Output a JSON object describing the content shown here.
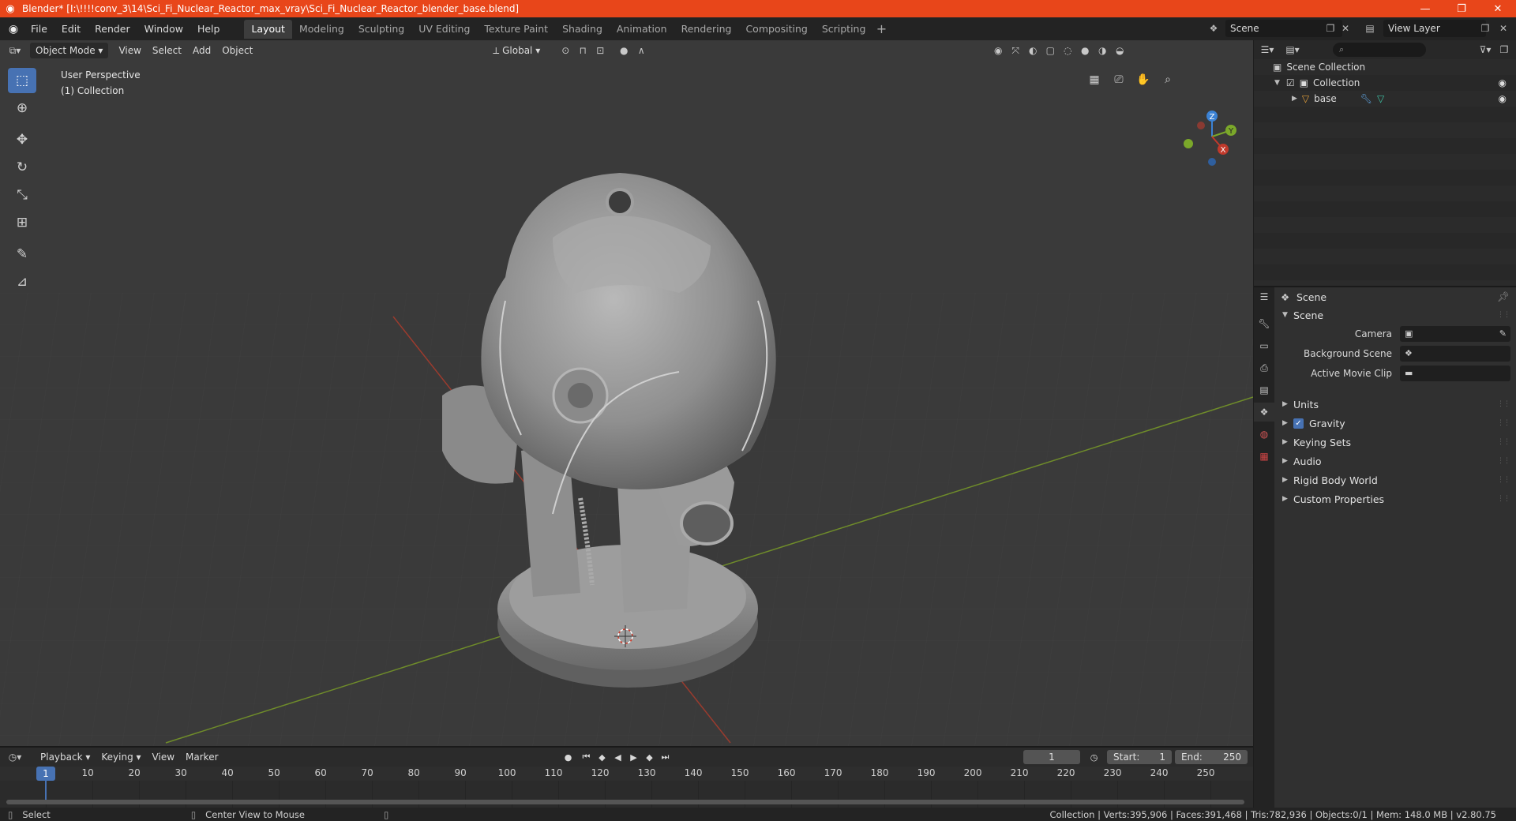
{
  "title": "Blender* [I:\\!!!!conv_3\\14\\Sci_Fi_Nuclear_Reactor_max_vray\\Sci_Fi_Nuclear_Reactor_blender_base.blend]",
  "menu": [
    "File",
    "Edit",
    "Render",
    "Window",
    "Help"
  ],
  "workspaces": [
    "Layout",
    "Modeling",
    "Sculpting",
    "UV Editing",
    "Texture Paint",
    "Shading",
    "Animation",
    "Rendering",
    "Compositing",
    "Scripting"
  ],
  "active_workspace": "Layout",
  "scene_name": "Scene",
  "view_layer": "View Layer",
  "viewport": {
    "mode": "Object Mode",
    "menus": [
      "View",
      "Select",
      "Add",
      "Object"
    ],
    "orientation": "Global",
    "perspective": "User Perspective",
    "collection": "(1) Collection"
  },
  "outliner": {
    "root": "Scene Collection",
    "collection": "Collection",
    "object": "base"
  },
  "properties": {
    "header": "Scene",
    "panel_title": "Scene",
    "fields": [
      {
        "label": "Camera"
      },
      {
        "label": "Background Scene"
      },
      {
        "label": "Active Movie Clip"
      }
    ],
    "sections": [
      "Units",
      "Gravity",
      "Keying Sets",
      "Audio",
      "Rigid Body World",
      "Custom Properties"
    ]
  },
  "timeline": {
    "menus": [
      "Playback",
      "Keying",
      "View",
      "Marker"
    ],
    "current_frame": "1",
    "start_label": "Start:",
    "start": "1",
    "end_label": "End:",
    "end": "250",
    "ticks": [
      "10",
      "20",
      "30",
      "40",
      "50",
      "60",
      "70",
      "80",
      "90",
      "100",
      "110",
      "120",
      "130",
      "140",
      "150",
      "160",
      "170",
      "180",
      "190",
      "200",
      "210",
      "220",
      "230",
      "240",
      "250"
    ]
  },
  "status": {
    "left_action": "Select",
    "mid_action": "Center View to Mouse",
    "stats": "Collection | Verts:395,906 | Faces:391,468 | Tris:782,936 | Objects:0/1 | Mem: 148.0 MB | v2.80.75"
  },
  "colors": {
    "titlebar": "#e8461a",
    "accent": "#4772b3",
    "x_axis": "#c0392b",
    "y_axis": "#7ba82a",
    "z_axis": "#3b82d4"
  }
}
